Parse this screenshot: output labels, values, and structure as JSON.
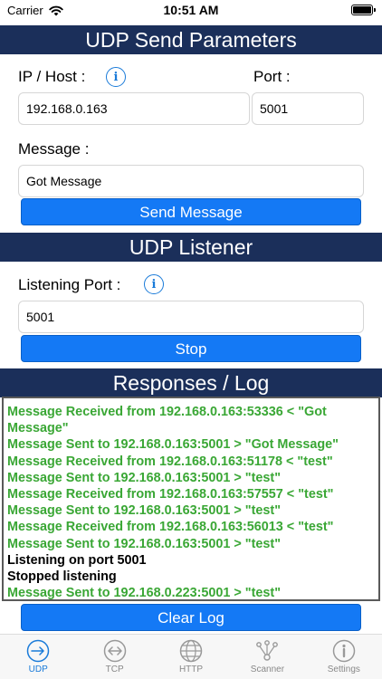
{
  "status_bar": {
    "carrier": "Carrier",
    "time": "10:51 AM"
  },
  "send_section": {
    "title": "UDP Send Parameters",
    "host_label": "IP / Host :",
    "port_label": "Port :",
    "host_value": "192.168.0.163",
    "port_value": "5001",
    "message_label": "Message :",
    "message_value": "Got Message",
    "send_button": "Send Message"
  },
  "listener_section": {
    "title": "UDP Listener",
    "port_label": "Listening Port :",
    "port_value": "5001",
    "stop_button": "Stop"
  },
  "log_section": {
    "title": "Responses / Log",
    "lines": [
      {
        "text": "Message Received from 192.168.0.163:53336 < \"Got Message\"",
        "color": "#3aa735"
      },
      {
        "text": "Message Sent to 192.168.0.163:5001 > \"Got Message\"",
        "color": "#3aa735"
      },
      {
        "text": "Message Received from 192.168.0.163:51178 < \"test\"",
        "color": "#3aa735"
      },
      {
        "text": "Message Sent to 192.168.0.163:5001 > \"test\"",
        "color": "#3aa735"
      },
      {
        "text": "Message Received from 192.168.0.163:57557 < \"test\"",
        "color": "#3aa735"
      },
      {
        "text": "Message Sent to 192.168.0.163:5001 > \"test\"",
        "color": "#3aa735"
      },
      {
        "text": "Message Received from 192.168.0.163:56013 < \"test\"",
        "color": "#3aa735"
      },
      {
        "text": "Message Sent to 192.168.0.163:5001 > \"test\"",
        "color": "#3aa735"
      },
      {
        "text": "Listening on port 5001",
        "color": "#000000"
      },
      {
        "text": "Stopped listening",
        "color": "#000000"
      },
      {
        "text": "Message Sent to 192.168.0.223:5001 > \"test\"",
        "color": "#3aa735"
      }
    ],
    "clear_button": "Clear Log"
  },
  "tabs": [
    {
      "label": "UDP",
      "icon": "udp-arrow-icon",
      "active": true
    },
    {
      "label": "TCP",
      "icon": "tcp-double-arrow-icon",
      "active": false
    },
    {
      "label": "HTTP",
      "icon": "globe-icon",
      "active": false
    },
    {
      "label": "Scanner",
      "icon": "network-scanner-icon",
      "active": false
    },
    {
      "label": "Settings",
      "icon": "info-settings-icon",
      "active": false
    }
  ],
  "colors": {
    "header_bg": "#1b2f5a",
    "button_bg": "#1479f5",
    "log_green": "#3aa735",
    "accent": "#1a7bd9"
  }
}
